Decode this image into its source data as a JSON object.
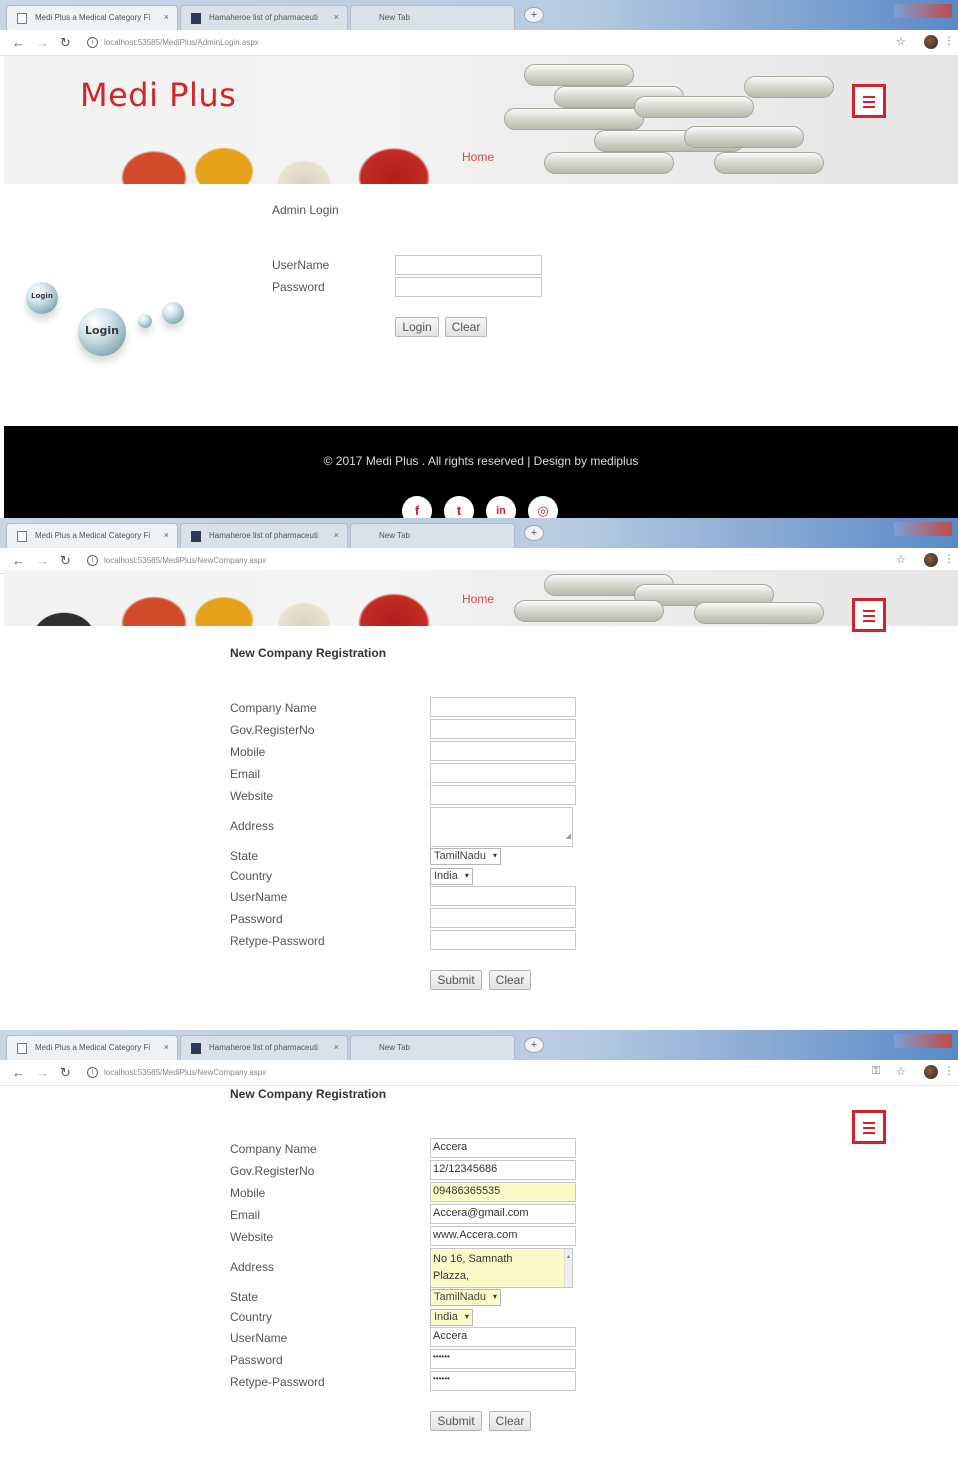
{
  "browser": {
    "tabs": [
      "Medi Plus a Medical Category Fi",
      "Hamaheroe list of pharmaceuti",
      "New Tab"
    ],
    "new_tab_icon": "plus-icon",
    "url_login": "localhost:53585/MediPlus/AdminLogin.aspx",
    "url_register": "localhost:53585/MediPlus/NewCompany.aspx"
  },
  "site": {
    "brand": "Medi Plus",
    "home": "Home",
    "accent_color": "#d32029"
  },
  "login": {
    "heading": "Admin Login",
    "username_label": "UserName",
    "password_label": "Password",
    "login_button": "Login",
    "clear_button": "Clear",
    "art_text_large": "Login",
    "art_text_small": "Login"
  },
  "footer": {
    "text": "© 2017 Medi Plus . All rights reserved | Design by mediplus",
    "social": [
      "f",
      "t",
      "in",
      "◎"
    ]
  },
  "registration": {
    "heading": "New Company Registration",
    "labels": {
      "company_name": "Company Name",
      "reg_no": "Gov.RegisterNo",
      "mobile": "Mobile",
      "email": "Email",
      "website": "Website",
      "address": "Address",
      "state": "State",
      "country": "Country",
      "username": "UserName",
      "password": "Password",
      "retype": "Retype-Password"
    },
    "state_value": "TamilNadu",
    "country_value": "India",
    "submit_button": "Submit",
    "clear_button": "Clear"
  },
  "registration_filled": {
    "company_name": "Accera",
    "reg_no": "12/12345686",
    "mobile": "09486365535",
    "email": "Accera@gmail.com",
    "website": "www.Accera.com",
    "address_line1": "No 16, Samnath",
    "address_line2": "Plazza,",
    "state": "TamilNadu",
    "country": "India",
    "username": "Accera",
    "password": "••••••",
    "retype": "••••••"
  }
}
